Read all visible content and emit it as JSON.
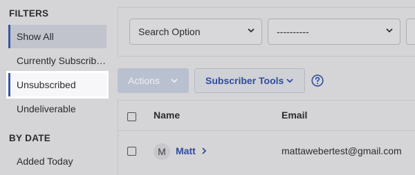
{
  "sidebar": {
    "filters_heading": "FILTERS",
    "filter_items": [
      {
        "label": "Show All"
      },
      {
        "label": "Currently Subscribed"
      },
      {
        "label": "Unsubscribed"
      },
      {
        "label": "Undeliverable"
      }
    ],
    "by_date_heading": "BY DATE",
    "date_items": [
      {
        "label": "Added Today"
      }
    ]
  },
  "filter_bar": {
    "search_option": "Search Option",
    "second_select": "----------"
  },
  "toolbar": {
    "actions_label": "Actions",
    "subscriber_tools_label": "Subscriber Tools"
  },
  "table": {
    "columns": {
      "name": "Name",
      "email": "Email"
    },
    "rows": [
      {
        "avatar": "M",
        "name": "Matt",
        "email": "mattawebertest@gmail.com"
      }
    ]
  },
  "colors": {
    "accent": "#3c55a6",
    "link": "#2e4c9c",
    "overlay_bg": "#d5d5d7",
    "highlight": "#ffffff"
  }
}
